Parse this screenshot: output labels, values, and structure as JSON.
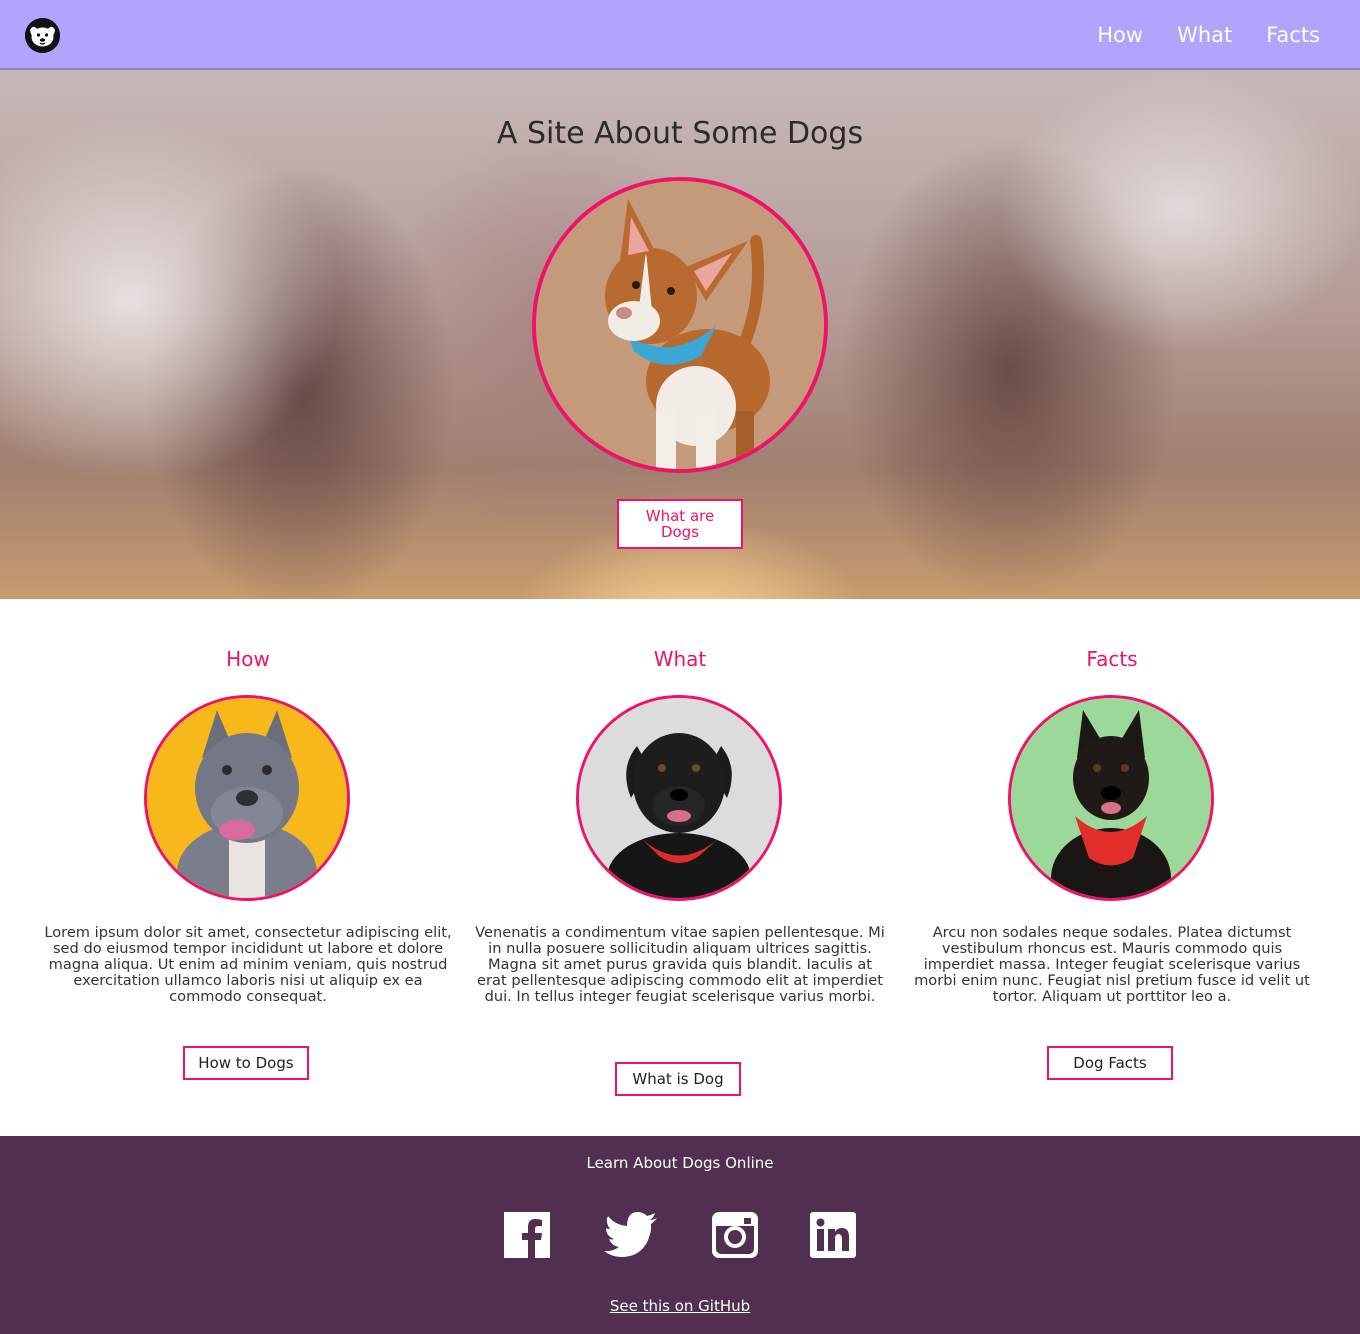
{
  "header": {
    "logo": "dog-face-icon",
    "nav": [
      "How",
      "What",
      "Facts"
    ]
  },
  "hero": {
    "title": "A Site About Some Dogs",
    "cta_label": "What are Dogs"
  },
  "features": [
    {
      "title": "How",
      "text": "Lorem ipsum dolor sit amet, consectetur adipiscing elit, sed do eiusmod tempor incididunt ut labore et dolore magna aliqua. Ut enim ad minim veniam, quis nostrud exercitation ullamco laboris nisi ut aliquip ex ea commodo consequat.",
      "button": "How to Dogs"
    },
    {
      "title": "What",
      "text": "Venenatis a condimentum vitae sapien pellentesque. Mi in nulla posuere sollicitudin aliquam ultrices sagittis. Magna sit amet purus gravida quis blandit. Iaculis at erat pellentesque adipiscing commodo elit at imperdiet dui. In tellus integer feugiat scelerisque varius morbi.",
      "button": "What is Dog"
    },
    {
      "title": "Facts",
      "text": "Arcu non sodales neque sodales. Platea dictumst vestibulum rhoncus est. Mauris commodo quis imperdiet massa. Integer feugiat scelerisque varius morbi enim nunc. Feugiat nisl pretium fusce id velit ut tortor. Aliquam ut porttitor leo a.",
      "button": "Dog Facts"
    }
  ],
  "footer": {
    "title": "Learn About Dogs Online",
    "social": [
      "facebook-icon",
      "twitter-icon",
      "instagram-icon",
      "linkedin-icon"
    ],
    "github_link": "See this on GitHub"
  },
  "colors": {
    "header_bg": "#b0a4ff",
    "accent": "#ee1269",
    "footer_bg": "#512f51"
  }
}
